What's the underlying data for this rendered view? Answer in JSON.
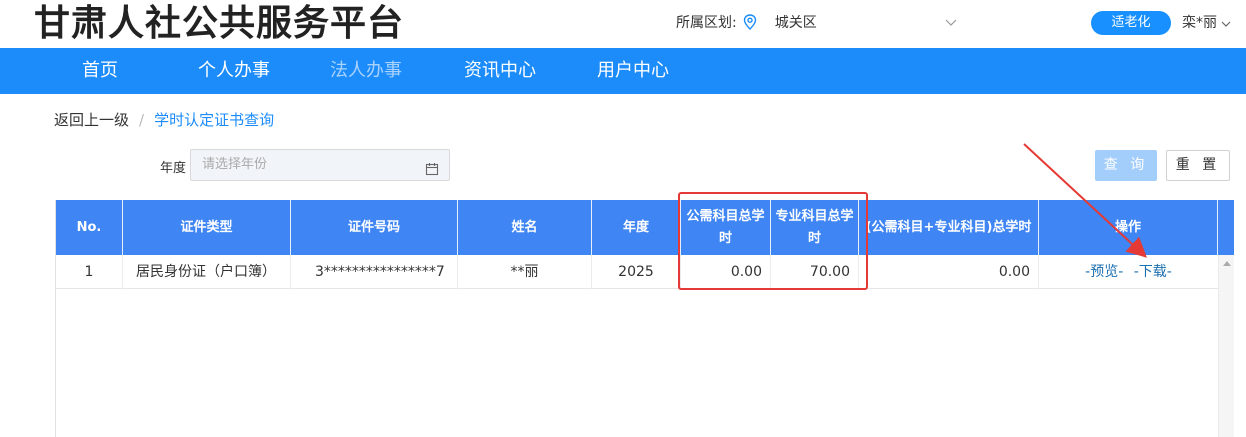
{
  "header": {
    "site_title": "甘肃人社公共服务平台",
    "region_label": "所属区划:",
    "region_value": "城关区",
    "elder_mode_label": "适老化",
    "user_name": "栾*丽"
  },
  "nav": {
    "items": [
      {
        "label": "首页"
      },
      {
        "label": "个人办事"
      },
      {
        "label": "法人办事"
      },
      {
        "label": "资讯中心"
      },
      {
        "label": "用户中心"
      }
    ]
  },
  "breadcrumb": {
    "back": "返回上一级",
    "separator": "/",
    "current": "学时认定证书查询"
  },
  "filter": {
    "year_label": "年度",
    "year_placeholder": "请选择年份",
    "query_label": "查 询",
    "reset_label": "重 置"
  },
  "table": {
    "headers": [
      "No.",
      "证件类型",
      "证件号码",
      "姓名",
      "年度",
      "公需科目总学时",
      "专业科目总学时",
      "(公需科目+专业科目)总学时",
      "操作"
    ],
    "rows": [
      {
        "no": "1",
        "id_type": "居民身份证（户口簿）",
        "id_number": "3****************7",
        "name": "**丽",
        "year": "2025",
        "public_hours": "0.00",
        "professional_hours": "70.00",
        "total_hours": "0.00",
        "preview": "-预览-",
        "download": "-下载-"
      }
    ]
  },
  "colors": {
    "nav_bg": "#1c8cfb",
    "table_header_bg": "#3f86f4",
    "annotation_red": "#e53935"
  }
}
